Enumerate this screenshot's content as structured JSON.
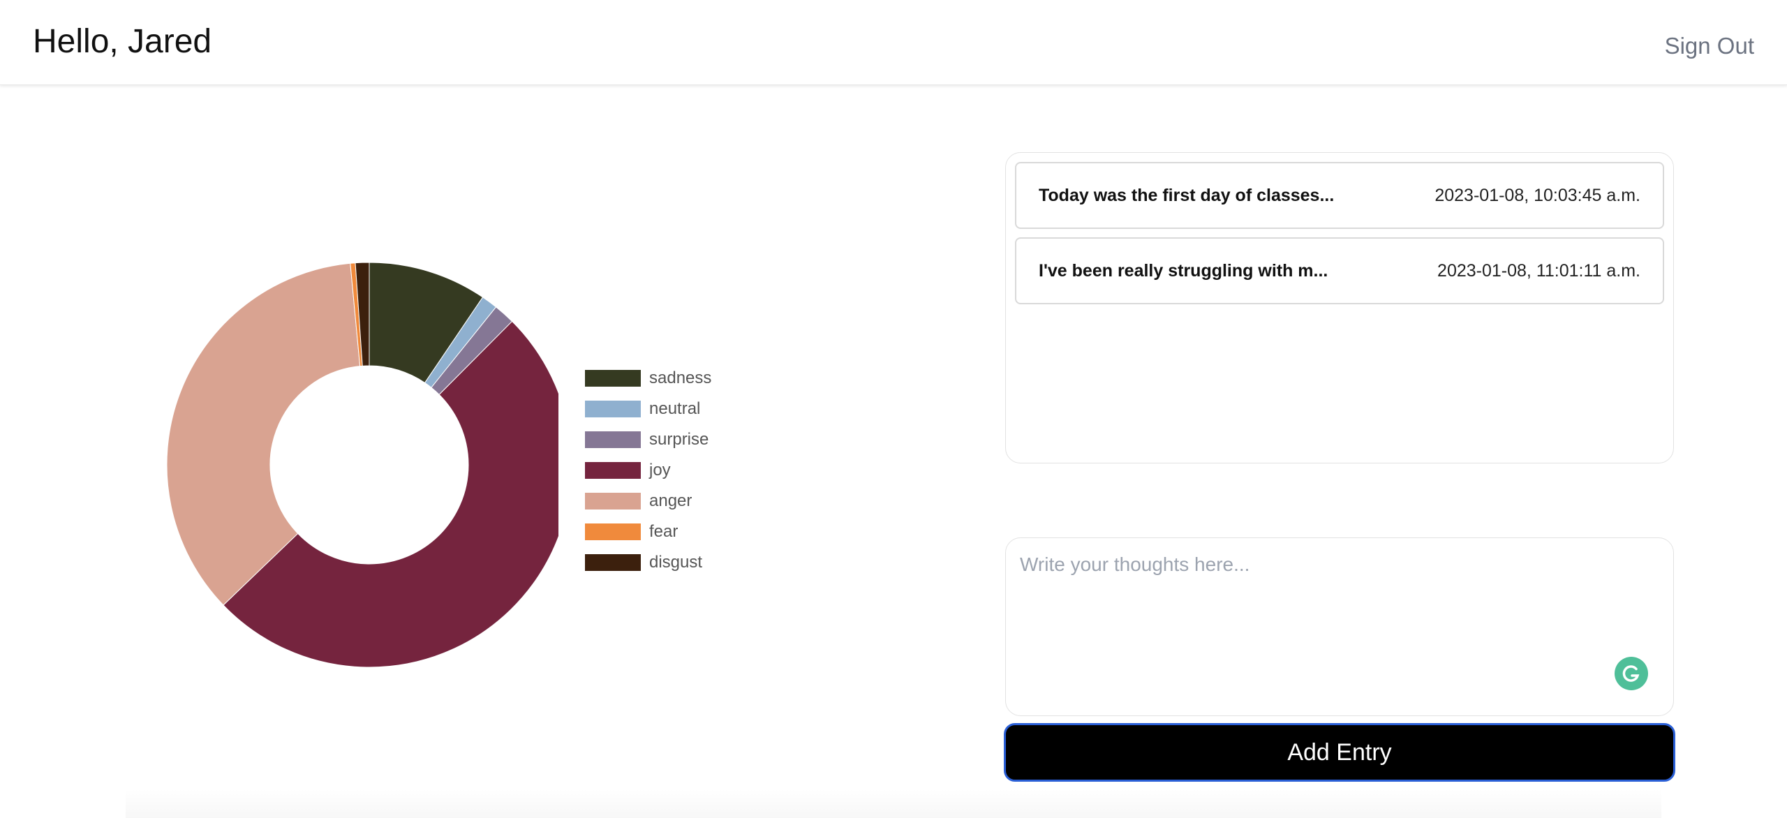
{
  "header": {
    "greeting": "Hello, Jared",
    "sign_out_label": "Sign Out"
  },
  "chart_data": {
    "type": "pie",
    "donut": true,
    "title": "",
    "legend_position": "right",
    "slices": [
      {
        "label": "sadness",
        "value": 9.5,
        "color": "#353a21"
      },
      {
        "label": "neutral",
        "value": 1.3,
        "color": "#8fb0cf"
      },
      {
        "label": "surprise",
        "value": 1.7,
        "color": "#857795"
      },
      {
        "label": "joy",
        "value": 50.5,
        "color": "#75243e"
      },
      {
        "label": "anger",
        "value": 35.8,
        "color": "#d9a391"
      },
      {
        "label": "fear",
        "value": 0.4,
        "color": "#f08a3c"
      },
      {
        "label": "disgust",
        "value": 1.1,
        "color": "#3c200d"
      }
    ]
  },
  "entries": [
    {
      "title": "Today was the first day of classes...",
      "date": "2023-01-08, 10:03:45 a.m."
    },
    {
      "title": "I've been really struggling with m...",
      "date": "2023-01-08, 11:01:11 a.m."
    }
  ],
  "composer": {
    "placeholder": "Write your thoughts here...",
    "value": "",
    "add_label": "Add Entry",
    "grammarly_icon": "grammarly-icon",
    "grammarly_color": "#4fbf99"
  },
  "colors": {
    "button_bg": "#000000",
    "button_border": "#2a5fd6",
    "sign_out": "#6b7280"
  }
}
